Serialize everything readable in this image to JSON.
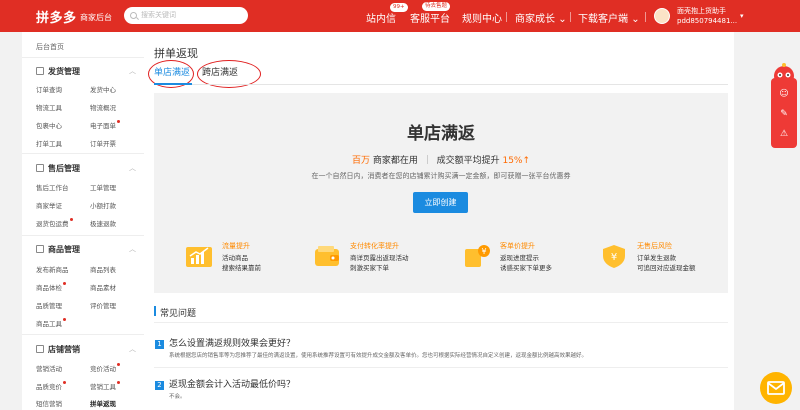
{
  "topbar": {
    "logo": "拼多多",
    "logo_sub": "商家后台",
    "search_placeholder": "搜索关键词",
    "nav": [
      {
        "label": "站内信",
        "badge": "99+"
      },
      {
        "label": "客服平台",
        "badge": "待去售题"
      },
      {
        "label": "规则中心"
      },
      {
        "label": "商家成长",
        "caret": "⌄"
      },
      {
        "label": "下载客户端",
        "caret": "⌄"
      }
    ],
    "user_name": "面壳抱上货助手",
    "user_id": "pdd850794481...",
    "user_caret": "▾"
  },
  "sidebar": {
    "home": "后台首页",
    "sections": [
      {
        "title": "发货管理",
        "icon": "truck-icon",
        "chevron": "︿",
        "items": [
          [
            "订单查询",
            "发货中心"
          ],
          [
            "物流工具",
            "物流概况"
          ],
          [
            "包裹中心",
            "电子面单"
          ],
          [
            "打单工具",
            "订单开票"
          ]
        ]
      },
      {
        "title": "售后管理",
        "icon": "service-icon",
        "chevron": "︿",
        "items": [
          [
            "售后工作台",
            "工单管理"
          ],
          [
            "商家举证",
            "小额打款"
          ],
          [
            "退货包运费",
            "极速退款"
          ]
        ]
      },
      {
        "title": "商品管理",
        "icon": "goods-icon",
        "chevron": "︿",
        "items": [
          [
            "发布新商品",
            "商品列表"
          ],
          [
            "商品体检",
            "商品素材"
          ],
          [
            "品质管理",
            "评价管理"
          ],
          [
            "商品工具",
            ""
          ]
        ]
      },
      {
        "title": "店铺营销",
        "icon": "marketing-icon",
        "chevron": "︿",
        "items": [
          [
            "营销活动",
            "竞价活动"
          ],
          [
            "品质竞价",
            "营销工具"
          ],
          [
            "短信营销",
            "拼单返现"
          ]
        ]
      }
    ]
  },
  "main": {
    "page_title": "拼单返现",
    "tabs": [
      {
        "label": "单店满返",
        "active": true
      },
      {
        "label": "跨店满返",
        "active": false
      }
    ],
    "promo": {
      "title": "单店满返",
      "stat_num": "百万",
      "stat_text1": "商家都在用",
      "stat_text2": "成交额平均提升",
      "stat_pct": "15%",
      "stat_arrow": "↑",
      "desc": "在一个自然日内，消费者在您的店铺累计购买满一定金额，即可获赠一张平台优惠券",
      "cta": "立即创建",
      "features": [
        {
          "icon": "chart-up-icon",
          "title": "流量提升",
          "line1": "活动商品",
          "line2": "搜索结果靠前"
        },
        {
          "icon": "wallet-icon",
          "title": "支付转化率提升",
          "line1": "商详页露出返现活动",
          "line2": "刺激买家下单"
        },
        {
          "icon": "price-tag-icon",
          "title": "客单价提升",
          "line1": "返现进度提示",
          "line2": "诱惑买家下单更多"
        },
        {
          "icon": "shield-money-icon",
          "title": "无售后风险",
          "line1": "订单发生退款",
          "line2": "可追回对应返现金额"
        }
      ]
    },
    "faq": {
      "title": "常见问题",
      "items": [
        {
          "num": "1",
          "q": "怎么设置满返规则效果会更好？",
          "a": "系统根据您店的销售率等为您推荐了最佳的满返设置，使用系统推荐设置可有效提升成交金额及客单价。您也可根据实际经营情况自定义创建，返现金额比例越高效果越好。"
        },
        {
          "num": "2",
          "q": "返现金额会计入活动最低价吗？",
          "a": "不会。"
        }
      ]
    }
  },
  "colors": {
    "brand": "#e02e24",
    "accent": "#1b8be0",
    "highlight": "#ff6a00"
  }
}
